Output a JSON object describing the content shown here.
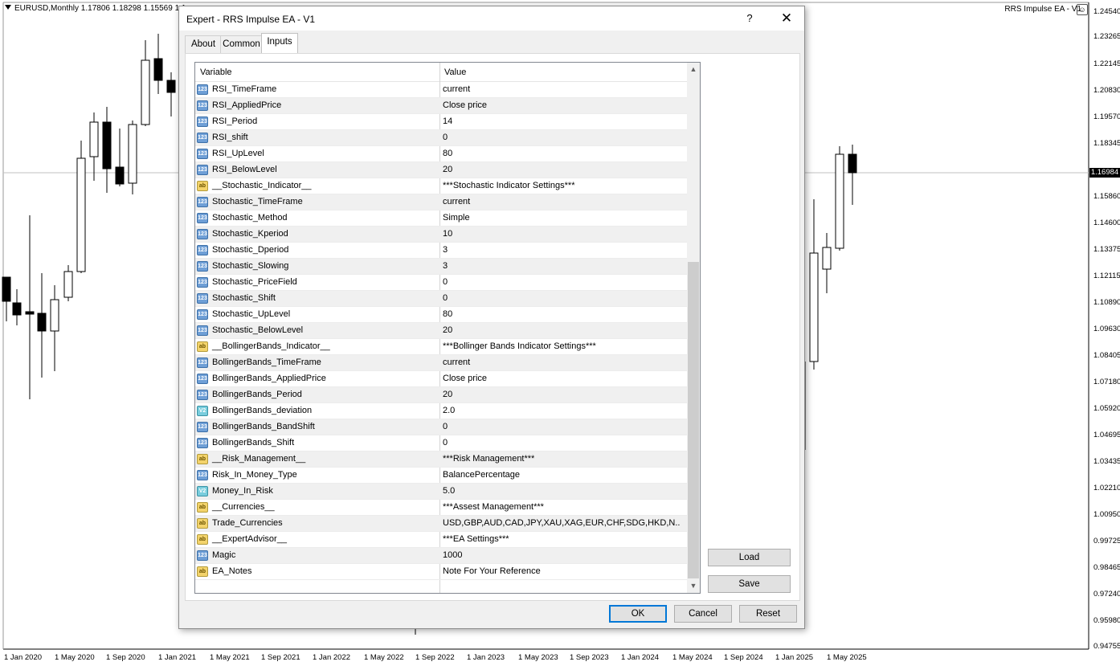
{
  "chart": {
    "symbol_info": "EURUSD,Monthly  1.17806 1.18298 1.15569 1.1",
    "ea_label": "RRS Impulse EA - V1",
    "ea_icon": "smiley-icon",
    "current_price": "1.16984",
    "price_labels": [
      "1.24540",
      "1.23265",
      "1.22145",
      "1.20830",
      "1.19570",
      "1.18345",
      "1.15860",
      "1.14600",
      "1.13375",
      "1.12115",
      "1.10890",
      "1.09630",
      "1.08405",
      "1.07180",
      "1.05920",
      "1.04695",
      "1.03435",
      "1.02210",
      "1.00950",
      "0.99725",
      "0.98465",
      "0.97240",
      "0.95980",
      "0.94755"
    ],
    "date_labels": [
      "1 Jan 2020",
      "1 May 2020",
      "1 Sep 2020",
      "1 Jan 2021",
      "1 May 2021",
      "1 Sep 2021",
      "1 Jan 2022",
      "1 May 2022",
      "1 Sep 2022",
      "1 Jan 2023",
      "1 May 2023",
      "1 Sep 2023",
      "1 Jan 2024",
      "1 May 2024",
      "1 Sep 2024",
      "1 Jan 2025",
      "1 May 2025"
    ]
  },
  "dialog": {
    "title": "Expert - RRS Impulse EA - V1",
    "help_label": "?",
    "close_label": "✕",
    "tabs": [
      {
        "label": "About"
      },
      {
        "label": "Common"
      },
      {
        "label": "Inputs"
      }
    ],
    "columns": {
      "variable": "Variable",
      "value": "Value"
    },
    "rows": [
      {
        "type": "num",
        "var": "RSI_TimeFrame",
        "val": "current"
      },
      {
        "type": "num",
        "var": "RSI_AppliedPrice",
        "val": "Close price"
      },
      {
        "type": "num",
        "var": "RSI_Period",
        "val": "14"
      },
      {
        "type": "num",
        "var": "RSI_shift",
        "val": "0"
      },
      {
        "type": "num",
        "var": "RSI_UpLevel",
        "val": "80"
      },
      {
        "type": "num",
        "var": "RSI_BelowLevel",
        "val": "20"
      },
      {
        "type": "str",
        "var": "__Stochastic_Indicator__",
        "val": "***Stochastic Indicator Settings***"
      },
      {
        "type": "num",
        "var": "Stochastic_TimeFrame",
        "val": "current"
      },
      {
        "type": "num",
        "var": "Stochastic_Method",
        "val": "Simple"
      },
      {
        "type": "num",
        "var": "Stochastic_Kperiod",
        "val": "10"
      },
      {
        "type": "num",
        "var": "Stochastic_Dperiod",
        "val": "3"
      },
      {
        "type": "num",
        "var": "Stochastic_Slowing",
        "val": "3"
      },
      {
        "type": "num",
        "var": "Stochastic_PriceField",
        "val": "0"
      },
      {
        "type": "num",
        "var": "Stochastic_Shift",
        "val": "0"
      },
      {
        "type": "num",
        "var": "Stochastic_UpLevel",
        "val": "80"
      },
      {
        "type": "num",
        "var": "Stochastic_BelowLevel",
        "val": "20"
      },
      {
        "type": "str",
        "var": "__BollingerBands_Indicator__",
        "val": "***Bollinger Bands Indicator Settings***"
      },
      {
        "type": "num",
        "var": "BollingerBands_TimeFrame",
        "val": "current"
      },
      {
        "type": "num",
        "var": "BollingerBands_AppliedPrice",
        "val": "Close price"
      },
      {
        "type": "num",
        "var": "BollingerBands_Period",
        "val": "20"
      },
      {
        "type": "dbl",
        "var": "BollingerBands_deviation",
        "val": "2.0"
      },
      {
        "type": "num",
        "var": "BollingerBands_BandShift",
        "val": "0"
      },
      {
        "type": "num",
        "var": "BollingerBands_Shift",
        "val": "0"
      },
      {
        "type": "str",
        "var": "__Risk_Management__",
        "val": "***Risk Management***"
      },
      {
        "type": "num",
        "var": "Risk_In_Money_Type",
        "val": "BalancePercentage"
      },
      {
        "type": "dbl",
        "var": "Money_In_Risk",
        "val": "5.0"
      },
      {
        "type": "str",
        "var": "__Currencies__",
        "val": "***Assest Management***"
      },
      {
        "type": "str",
        "var": "Trade_Currencies",
        "val": "USD,GBP,AUD,CAD,JPY,XAU,XAG,EUR,CHF,SDG,HKD,N..."
      },
      {
        "type": "str",
        "var": "__ExpertAdvisor__",
        "val": "***EA Settings***"
      },
      {
        "type": "num",
        "var": "Magic",
        "val": "1000"
      },
      {
        "type": "str",
        "var": "EA_Notes",
        "val": "Note For Your Reference"
      }
    ],
    "icon_text": {
      "num": "123",
      "str": "ab",
      "dbl": "V2"
    },
    "buttons": {
      "load": "Load",
      "save": "Save",
      "ok": "OK",
      "cancel": "Cancel",
      "reset": "Reset"
    }
  }
}
